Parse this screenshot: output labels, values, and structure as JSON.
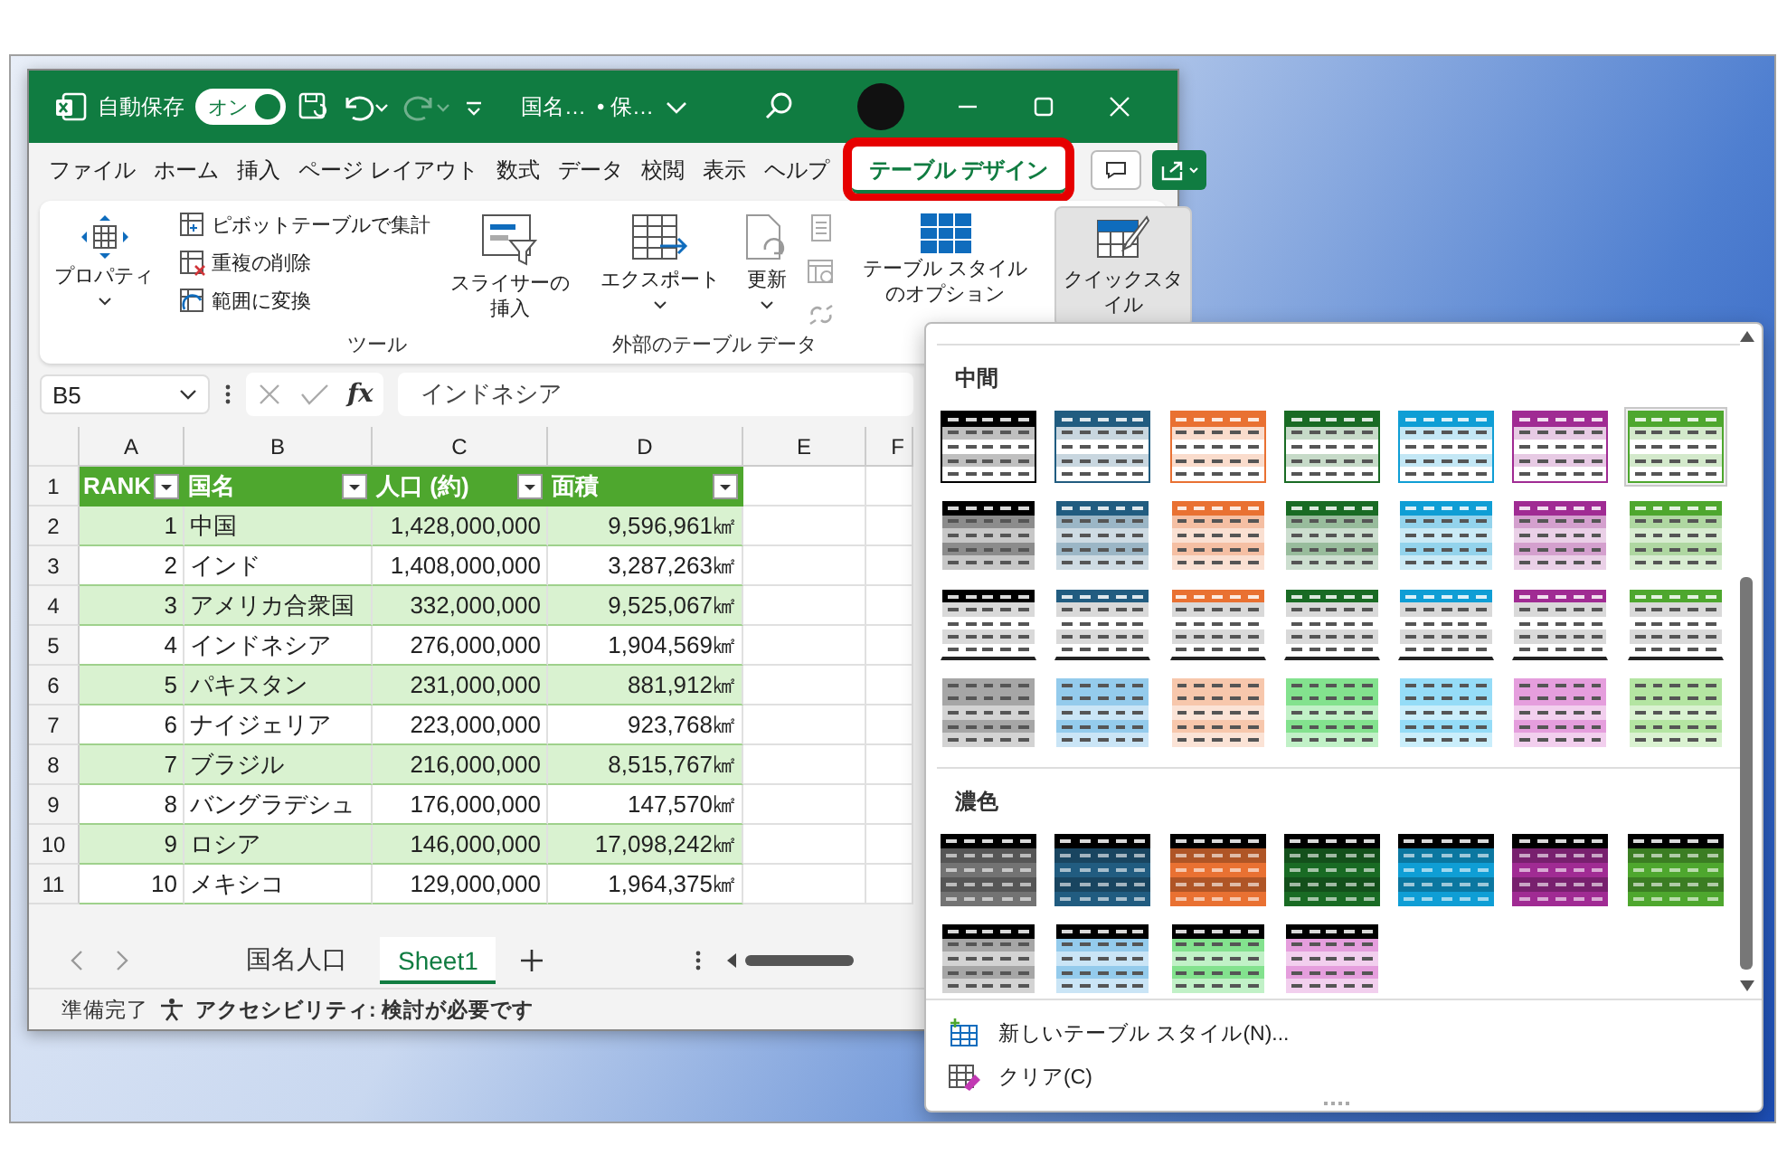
{
  "window": {
    "title": "国名…",
    "save_status": "• 保…",
    "autosave": {
      "label": "自動保存",
      "toggle": "オン",
      "on": true
    },
    "redo_disabled": true
  },
  "tabs": [
    {
      "label": "ファイル",
      "selected": false
    },
    {
      "label": "ホーム",
      "selected": false
    },
    {
      "label": "挿入",
      "selected": false
    },
    {
      "label": "ページ レイアウト",
      "selected": false
    },
    {
      "label": "数式",
      "selected": false
    },
    {
      "label": "データ",
      "selected": false
    },
    {
      "label": "校閲",
      "selected": false
    },
    {
      "label": "表示",
      "selected": false
    },
    {
      "label": "ヘルプ",
      "selected": false
    },
    {
      "label": "テーブル デザイン",
      "selected": true
    }
  ],
  "ribbon": {
    "properties": "プロパティ",
    "tools": {
      "label": "ツール",
      "items": [
        "ピボットテーブルで集計",
        "重複の削除",
        "範囲に変換"
      ],
      "slicer": "スライサーの挿入"
    },
    "external": {
      "label": "外部のテーブル データ",
      "export": "エクスポート",
      "refresh": "更新"
    },
    "style_options": "テーブル スタイルのオプション",
    "quick_styles": {
      "label": "クイックスタイル",
      "pressed": true
    }
  },
  "formula_bar": {
    "name_box": "B5",
    "function_button": "fx",
    "value": "インドネシア"
  },
  "sheet": {
    "columns": [
      "A",
      "B",
      "C",
      "D",
      "E",
      "F"
    ],
    "header_row": "1",
    "header": [
      "RANK",
      "国名",
      "人口 (約)",
      "面積"
    ],
    "rows": [
      {
        "num": "2",
        "cells": [
          "1",
          "中国",
          "1,428,000,000",
          "9,596,961㎢"
        ],
        "shaded": true
      },
      {
        "num": "3",
        "cells": [
          "2",
          "インド",
          "1,408,000,000",
          "3,287,263㎢"
        ],
        "shaded": false
      },
      {
        "num": "4",
        "cells": [
          "3",
          "アメリカ合衆国",
          "332,000,000",
          "9,525,067㎢"
        ],
        "shaded": true
      },
      {
        "num": "5",
        "cells": [
          "4",
          "インドネシア",
          "276,000,000",
          "1,904,569㎢"
        ],
        "shaded": false
      },
      {
        "num": "6",
        "cells": [
          "5",
          "パキスタン",
          "231,000,000",
          "881,912㎢"
        ],
        "shaded": true
      },
      {
        "num": "7",
        "cells": [
          "6",
          "ナイジェリア",
          "223,000,000",
          "923,768㎢"
        ],
        "shaded": false
      },
      {
        "num": "8",
        "cells": [
          "7",
          "ブラジル",
          "216,000,000",
          "8,515,767㎢"
        ],
        "shaded": true
      },
      {
        "num": "9",
        "cells": [
          "8",
          "バングラデシュ",
          "176,000,000",
          "147,570㎢"
        ],
        "shaded": false
      },
      {
        "num": "10",
        "cells": [
          "9",
          "ロシア",
          "146,000,000",
          "17,098,242㎢"
        ],
        "shaded": true
      },
      {
        "num": "11",
        "cells": [
          "10",
          "メキシコ",
          "129,000,000",
          "1,964,375㎢"
        ],
        "shaded": false
      }
    ]
  },
  "sheet_tabs": [
    {
      "label": "国名人口",
      "selected": false
    },
    {
      "label": "Sheet1",
      "selected": true
    }
  ],
  "status_bar": {
    "ready": "準備完了",
    "accessibility": "アクセシビリティ: 検討が必要です"
  },
  "gallery": {
    "sections": [
      {
        "heading": "中間",
        "rows": [
          {
            "kind": "banded",
            "swatches": [
              {
                "color": "#000000",
                "selected": false
              },
              {
                "color": "#215c80",
                "selected": false
              },
              {
                "color": "#e97132",
                "selected": false
              },
              {
                "color": "#196b24",
                "selected": false
              },
              {
                "color": "#0f9ed5",
                "selected": false
              },
              {
                "color": "#a02b93",
                "selected": false
              },
              {
                "color": "#4ea72e",
                "selected": true
              }
            ]
          },
          {
            "kind": "grid",
            "swatches": [
              {
                "color": "#000000",
                "selected": false
              },
              {
                "color": "#215c80",
                "selected": false
              },
              {
                "color": "#e97132",
                "selected": false
              },
              {
                "color": "#196b24",
                "selected": false
              },
              {
                "color": "#0f9ed5",
                "selected": false
              },
              {
                "color": "#a02b93",
                "selected": false
              },
              {
                "color": "#4ea72e",
                "selected": false
              }
            ]
          },
          {
            "kind": "lined",
            "swatches": [
              {
                "color": "#000000",
                "selected": false
              },
              {
                "color": "#215c80",
                "selected": false
              },
              {
                "color": "#e97132",
                "selected": false
              },
              {
                "color": "#196b24",
                "selected": false
              },
              {
                "color": "#0f9ed5",
                "selected": false
              },
              {
                "color": "#a02b93",
                "selected": false
              },
              {
                "color": "#4ea72e",
                "selected": false
              }
            ]
          },
          {
            "kind": "light",
            "swatches": [
              {
                "color": "#a6a6a6",
                "selected": false
              },
              {
                "color": "#94cbec",
                "selected": false
              },
              {
                "color": "#f7c7ac",
                "selected": false
              },
              {
                "color": "#83e28e",
                "selected": false
              },
              {
                "color": "#95dcf7",
                "selected": false
              },
              {
                "color": "#e59edd",
                "selected": false
              },
              {
                "color": "#b4e5a2",
                "selected": false
              }
            ]
          }
        ]
      },
      {
        "heading": "濃色",
        "rows": [
          {
            "kind": "dark",
            "swatches": [
              {
                "color": "#737373",
                "selected": false
              },
              {
                "color": "#215c80",
                "selected": false
              },
              {
                "color": "#e97132",
                "selected": false
              },
              {
                "color": "#196b24",
                "selected": false
              },
              {
                "color": "#0f9ed5",
                "selected": false
              },
              {
                "color": "#a02b93",
                "selected": false
              },
              {
                "color": "#4ea72e",
                "selected": false
              }
            ]
          },
          {
            "kind": "mixed",
            "swatches": [
              {
                "color": "#a6a6a6",
                "selected": false
              },
              {
                "color": "#94cbec",
                "selected": false
              },
              {
                "color": "#83e28e",
                "selected": false
              },
              {
                "color": "#e59edd",
                "selected": false
              }
            ]
          }
        ]
      }
    ],
    "actions": [
      "新しいテーブル スタイル(N)...",
      "クリア(C)"
    ]
  }
}
